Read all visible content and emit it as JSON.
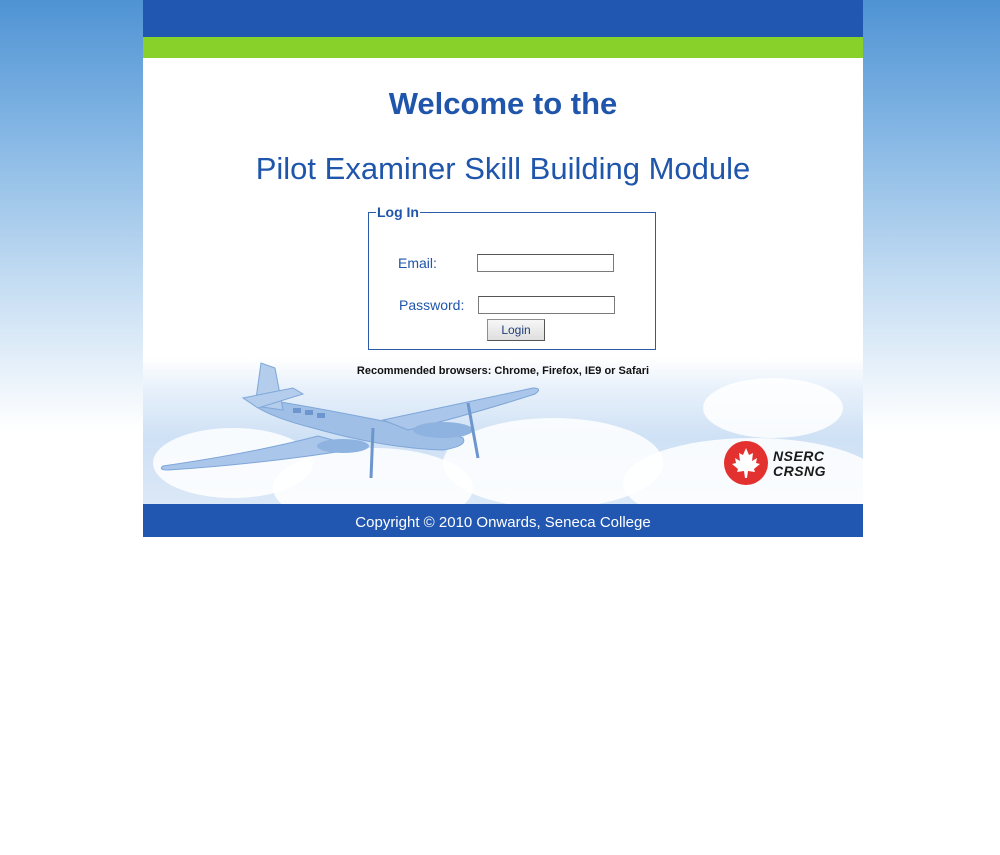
{
  "header": {
    "welcome": "Welcome to the",
    "module_title": "Pilot Examiner Skill Building Module"
  },
  "login": {
    "legend": "Log In",
    "email_label": "Email:",
    "email_value": "",
    "password_label": "Password:",
    "password_value": "",
    "button_label": "Login"
  },
  "recommended": "Recommended browsers: Chrome, Firefox, IE9 or Safari",
  "logo": {
    "line1": "NSERC",
    "line2": "CRSNG",
    "icon": "maple-leaf-icon",
    "color": "#e2312e"
  },
  "footer": {
    "copyright": "Copyright © 2010 Onwards, Seneca College"
  },
  "colors": {
    "brand_blue": "#2257b1",
    "accent_green": "#87d12a",
    "text_blue": "#1f55ab"
  }
}
